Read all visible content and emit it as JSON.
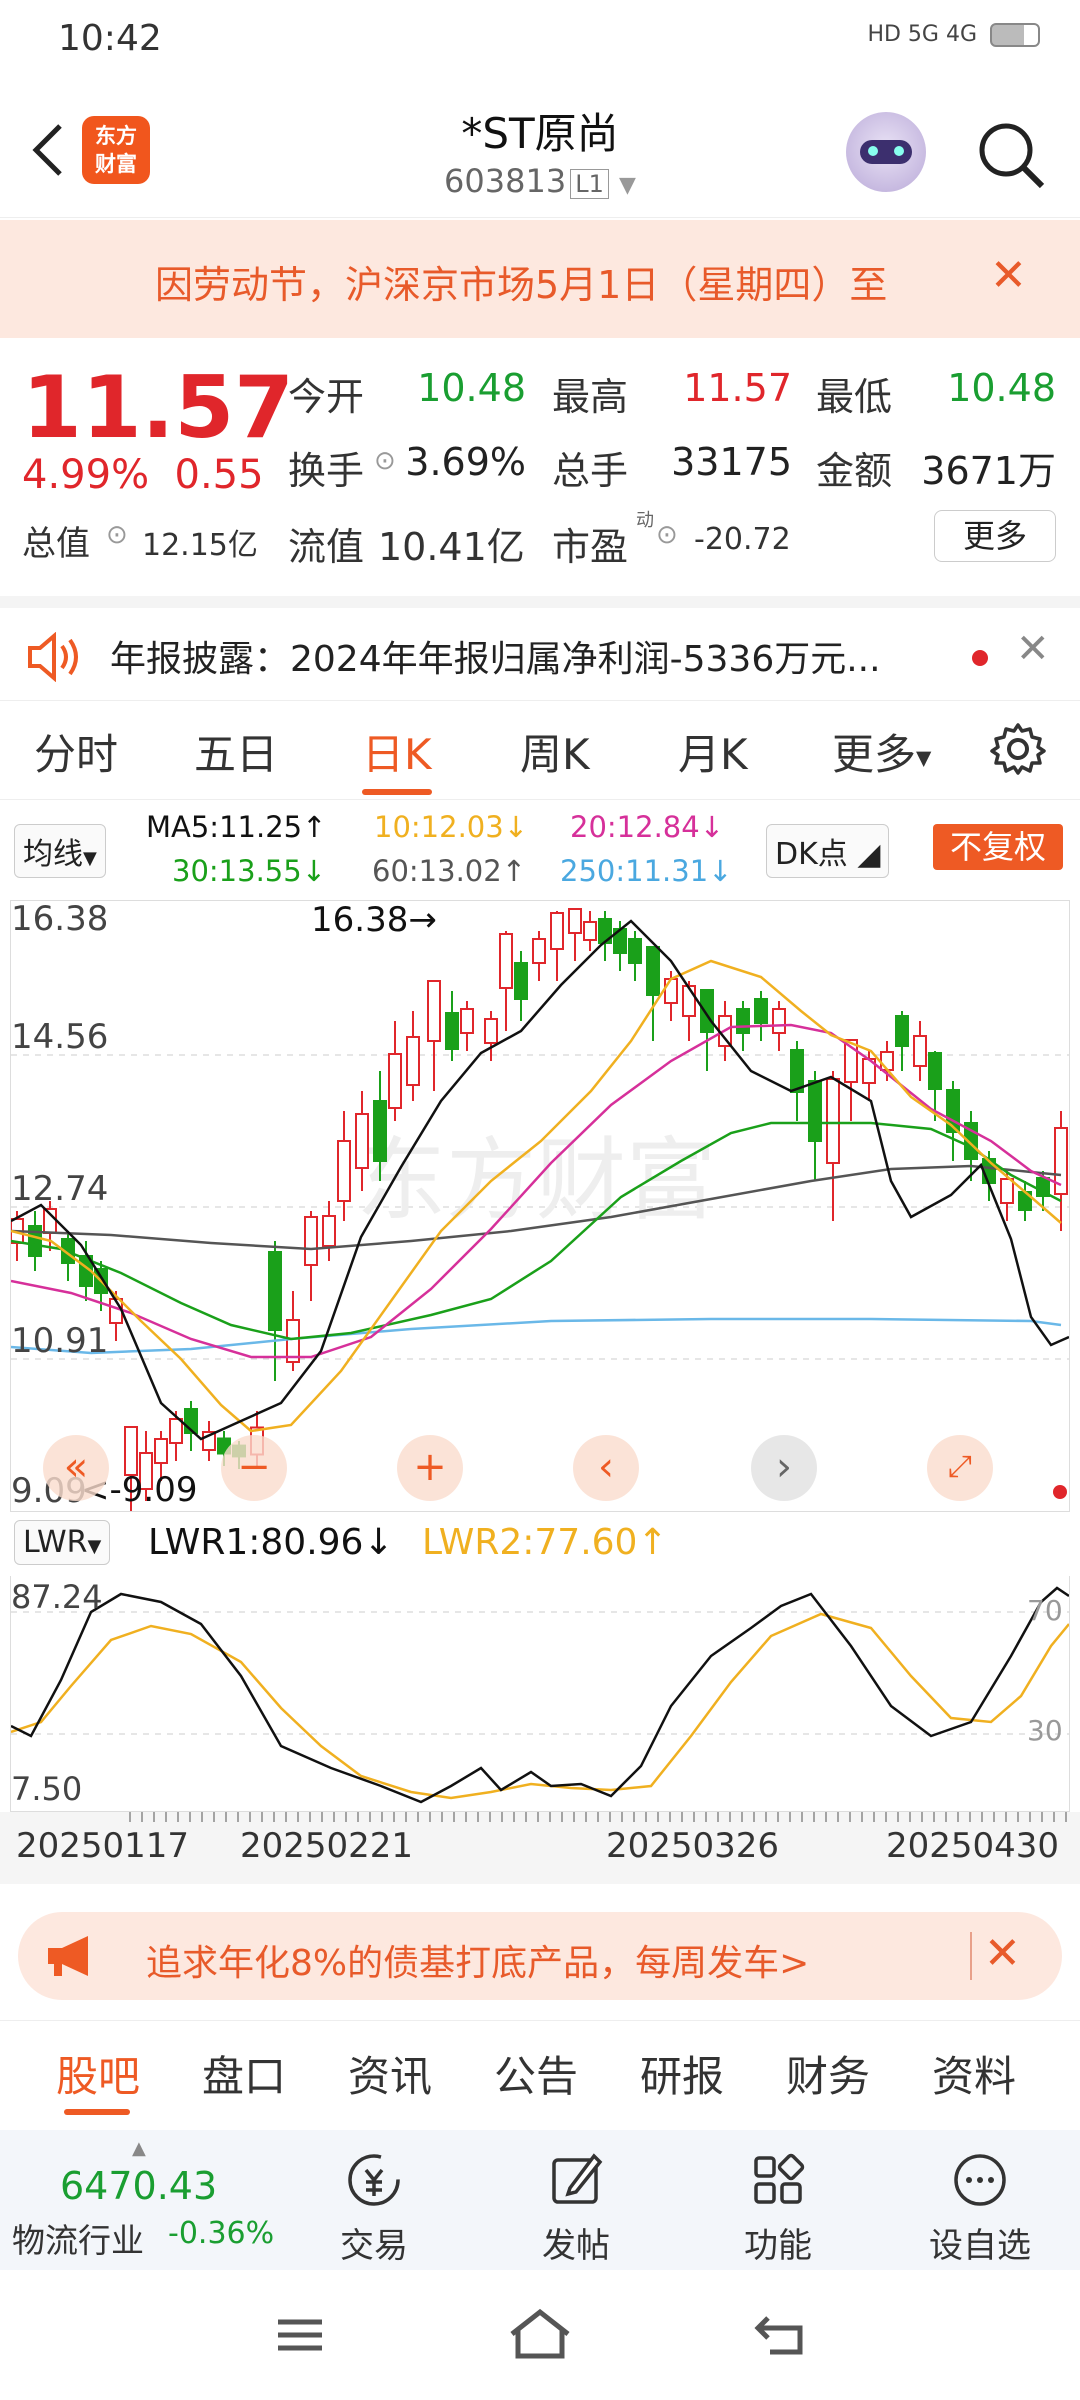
{
  "status": {
    "time": "10:42",
    "signal": "HD 5G 4G"
  },
  "header": {
    "logo_line1": "东方",
    "logo_line2": "财富",
    "title": "*ST原尚",
    "code": "603813",
    "level": "L1"
  },
  "notice": {
    "text": "因劳动节，沪深京市场5月1日（星期四）至",
    "close": "✕"
  },
  "quote": {
    "price": "11.57",
    "pct": "4.99%",
    "change": "0.55",
    "open_label": "今开",
    "open": "10.48",
    "high_label": "最高",
    "high": "11.57",
    "low_label": "最低",
    "low": "10.48",
    "turnover_label": "换手",
    "turnover": "3.69%",
    "volume_label": "总手",
    "volume": "33175",
    "amount_label": "金额",
    "amount": "3671万",
    "mcap_label": "总值",
    "mcap": "12.15亿",
    "float_label": "流值",
    "float_cap": "10.41亿",
    "pe_label": "市盈",
    "pe_sup": "动",
    "pe": "-20.72",
    "more": "更多"
  },
  "announcement": {
    "text": "年报披露：2024年年报归属净利润-5336万元...",
    "close": "✕"
  },
  "tabs": [
    "分时",
    "五日",
    "日K",
    "周K",
    "月K",
    "更多"
  ],
  "ma": {
    "selector": "均线",
    "ma5": "MA5:11.25↑",
    "ma10": "10:12.03↓",
    "ma20": "20:12.84↓",
    "ma30": "30:13.55↓",
    "ma60": "60:13.02↑",
    "ma250": "250:11.31↓",
    "dk": "DK点",
    "fq": "不复权",
    "colors": {
      "ma5": "#111111",
      "ma10": "#f0b020",
      "ma20": "#d6309a",
      "ma30": "#1aa01a",
      "ma60": "#555555",
      "ma250": "#6ab8e8"
    }
  },
  "kchart": {
    "y_labels": [
      "16.38",
      "14.56",
      "12.74",
      "10.91",
      "9.09"
    ],
    "max_label": "16.38",
    "min_label": "9.09",
    "watermark": "东方财富"
  },
  "lwr": {
    "selector": "LWR",
    "lwr1": "LWR1:80.96",
    "lwr2": "LWR2:77.60",
    "y_top": "87.24",
    "y_bottom": "7.50",
    "level_70": "70",
    "level_30": "30"
  },
  "dates": [
    "20250117",
    "20250221",
    "20250326",
    "20250430"
  ],
  "promo": {
    "text": "追求年化8%的债基打底产品，每周发车>",
    "close": "✕"
  },
  "bottom_tabs": [
    "股吧",
    "盘口",
    "资讯",
    "公告",
    "研报",
    "财务",
    "资料"
  ],
  "index": {
    "value": "6470.43",
    "name": "物流行业",
    "change": "-0.36%"
  },
  "bottom_nav": [
    "交易",
    "发帖",
    "功能",
    "设自选"
  ]
}
